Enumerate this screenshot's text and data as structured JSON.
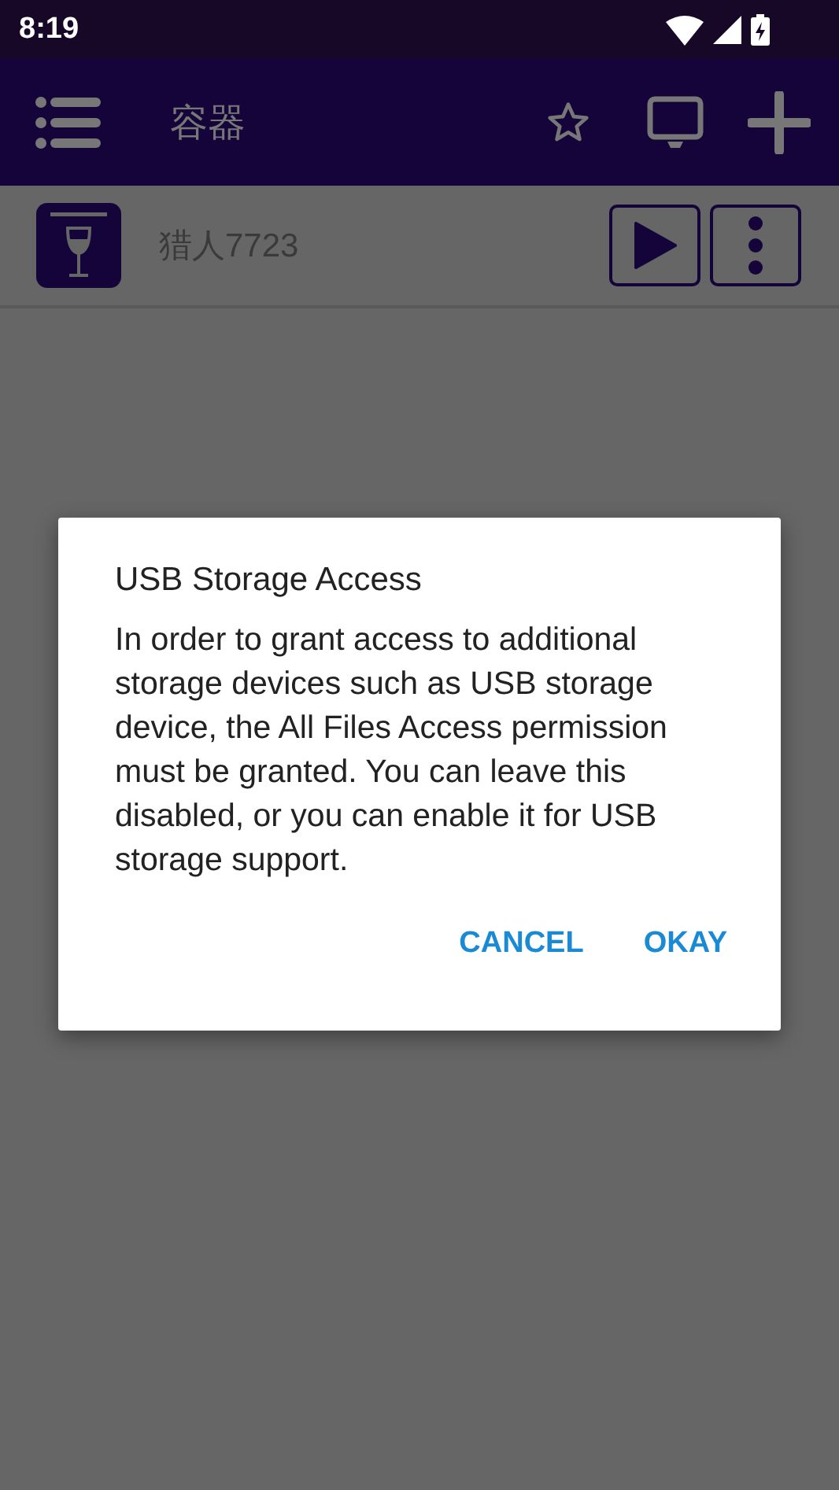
{
  "status_bar": {
    "time": "8:19"
  },
  "app_bar": {
    "title": "容器"
  },
  "containers": [
    {
      "name": "猎人7723"
    }
  ],
  "dialog": {
    "title": "USB Storage Access",
    "message": "In order to grant access to additional storage devices such as USB storage device, the All Files Access permission must be granted. You can leave this disabled, or you can enable it for USB storage support.",
    "buttons": [
      "CANCEL",
      "OKAY"
    ]
  }
}
